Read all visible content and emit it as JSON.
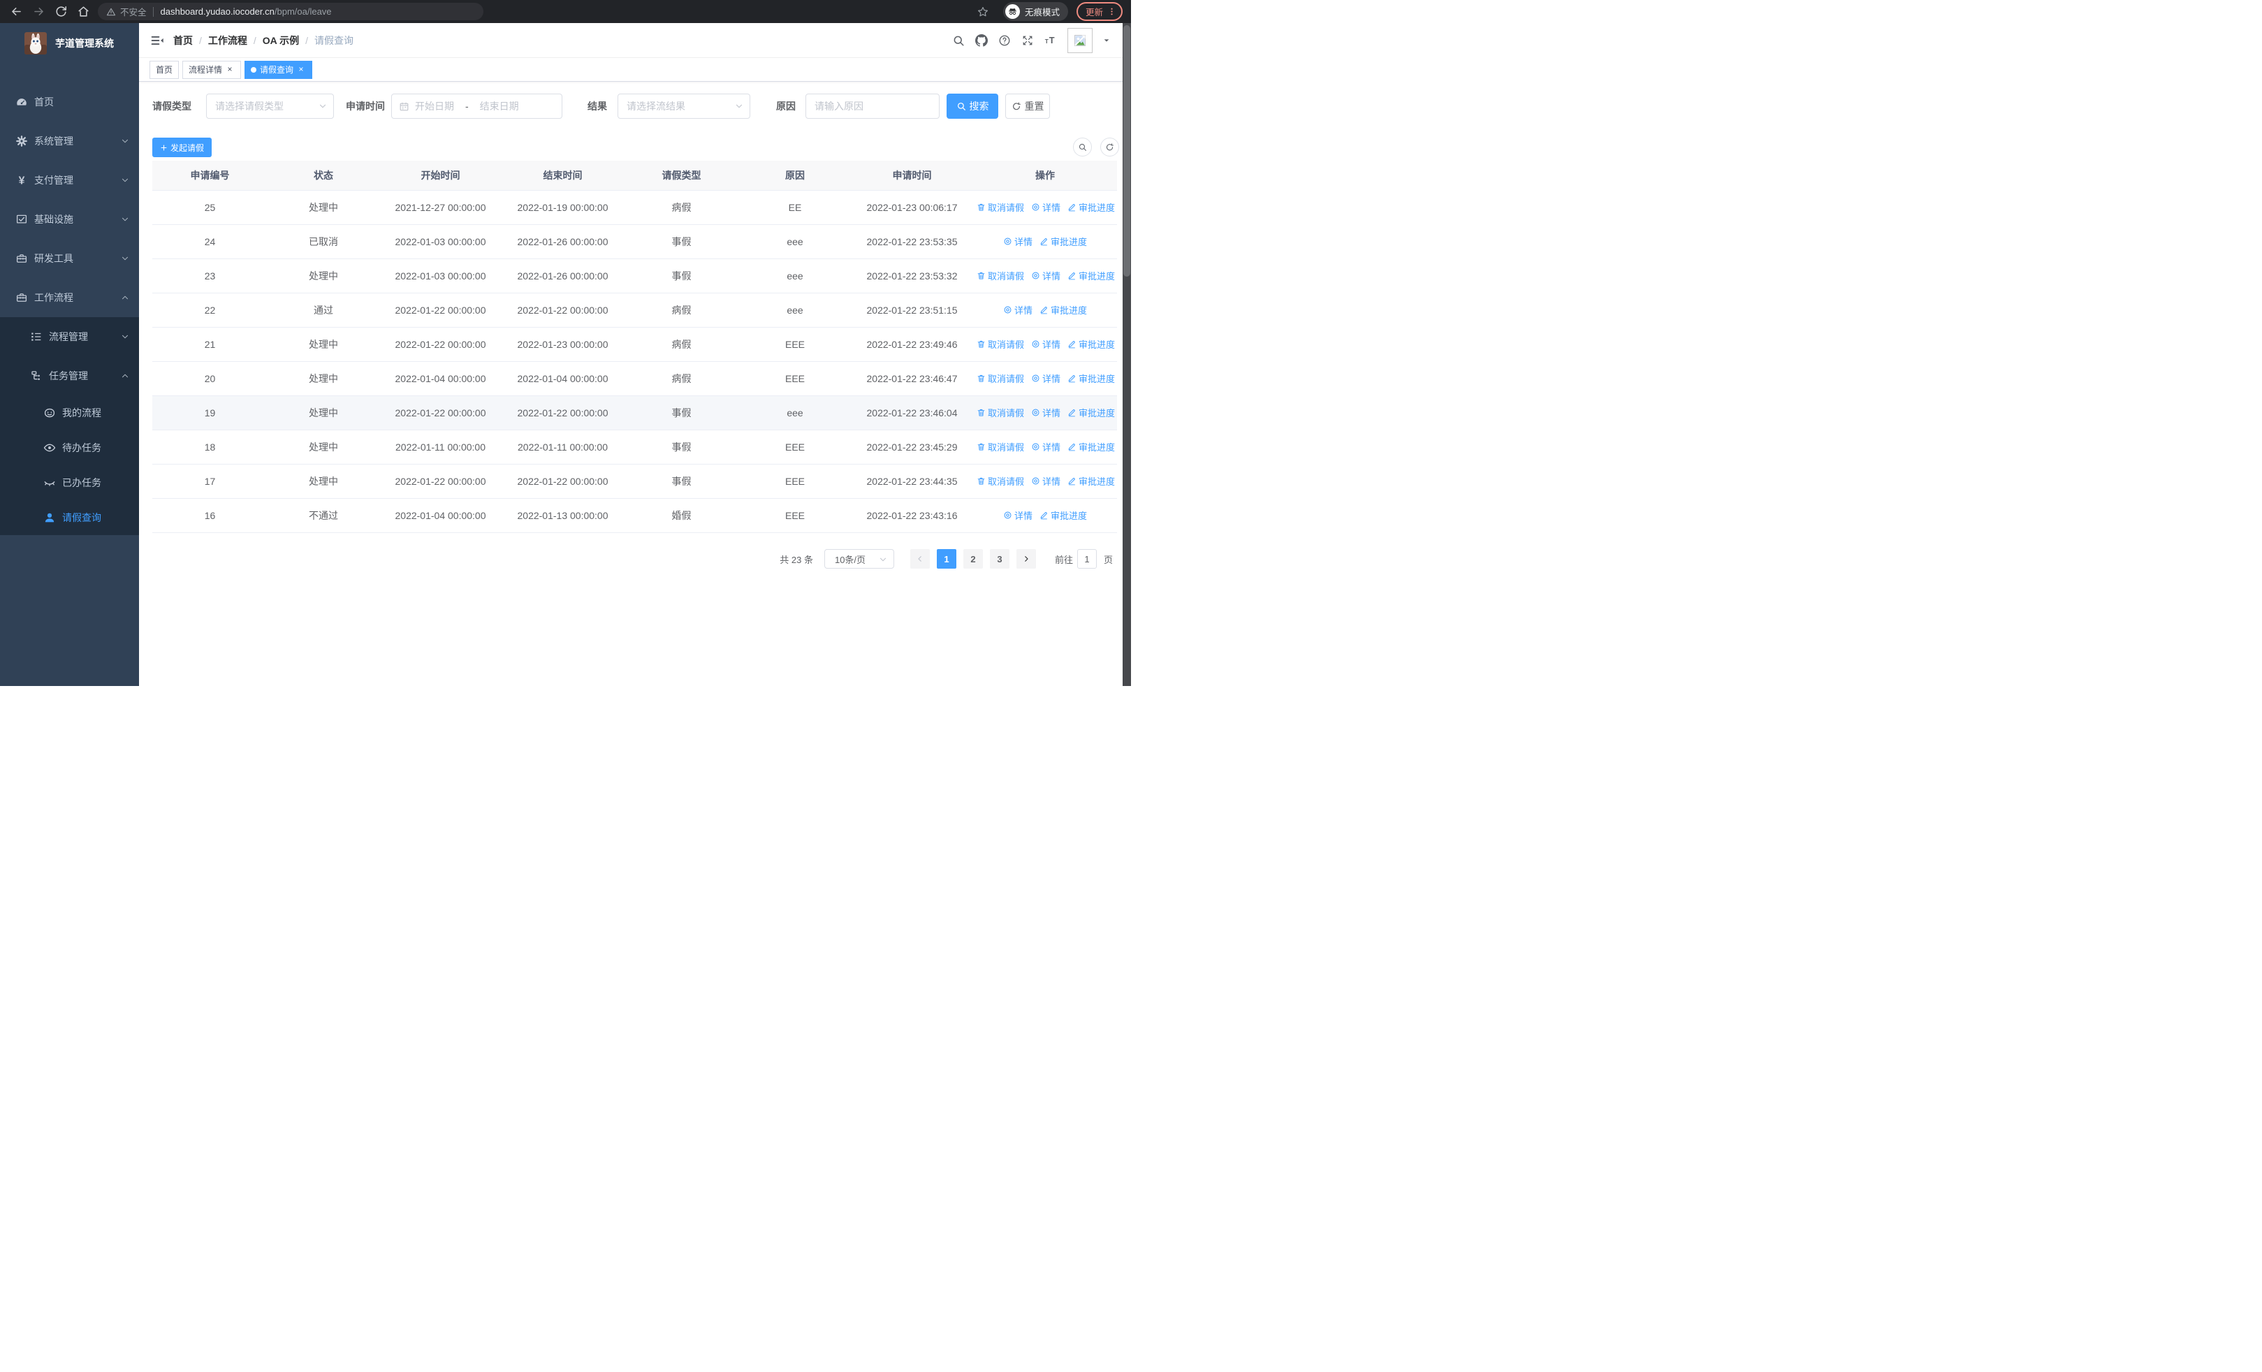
{
  "browser": {
    "security_label": "不安全",
    "url_domain": "dashboard.yudao.iocoder.cn",
    "url_path": "/bpm/oa/leave",
    "incognito_label": "无痕模式",
    "update_label": "更新"
  },
  "sidebar": {
    "app_title": "芋道管理系统",
    "items": [
      {
        "id": "home",
        "label": "首页",
        "icon": "dashboard-icon",
        "level": 1,
        "arrow": "",
        "sub": false,
        "active": false
      },
      {
        "id": "system",
        "label": "系统管理",
        "icon": "gear-icon",
        "level": 1,
        "arrow": "down",
        "sub": false,
        "active": false
      },
      {
        "id": "payment",
        "label": "支付管理",
        "icon": "yen-icon",
        "level": 1,
        "arrow": "down",
        "sub": false,
        "active": false
      },
      {
        "id": "infra",
        "label": "基础设施",
        "icon": "monitor-icon",
        "level": 1,
        "arrow": "down",
        "sub": false,
        "active": false
      },
      {
        "id": "devtools",
        "label": "研发工具",
        "icon": "toolbox-icon",
        "level": 1,
        "arrow": "down",
        "sub": false,
        "active": false
      },
      {
        "id": "workflow",
        "label": "工作流程",
        "icon": "toolbox-icon",
        "level": 1,
        "arrow": "up",
        "sub": false,
        "active": false
      },
      {
        "id": "process-mgmt",
        "label": "流程管理",
        "icon": "tree-icon",
        "level": 2,
        "arrow": "down",
        "sub": true,
        "active": false
      },
      {
        "id": "task-mgmt",
        "label": "任务管理",
        "icon": "flow-icon",
        "level": 2,
        "arrow": "up",
        "sub": true,
        "active": false
      },
      {
        "id": "my-process",
        "label": "我的流程",
        "icon": "face-icon",
        "level": 3,
        "arrow": "",
        "sub": true,
        "active": false
      },
      {
        "id": "todo-task",
        "label": "待办任务",
        "icon": "eye-open-icon",
        "level": 3,
        "arrow": "",
        "sub": true,
        "active": false
      },
      {
        "id": "done-task",
        "label": "已办任务",
        "icon": "eye-closed-icon",
        "level": 3,
        "arrow": "",
        "sub": true,
        "active": false
      },
      {
        "id": "leave-query",
        "label": "请假查询",
        "icon": "user-icon",
        "level": 3,
        "arrow": "",
        "sub": true,
        "active": true
      }
    ]
  },
  "header": {
    "breadcrumb": [
      "首页",
      "工作流程",
      "OA 示例",
      "请假查询"
    ]
  },
  "tabs": [
    {
      "label": "首页",
      "closable": false,
      "active": false
    },
    {
      "label": "流程详情",
      "closable": true,
      "active": false
    },
    {
      "label": "请假查询",
      "closable": true,
      "active": true
    }
  ],
  "filters": {
    "leave_type_label": "请假类型",
    "leave_type_placeholder": "请选择请假类型",
    "apply_time_label": "申请时间",
    "start_date_placeholder": "开始日期",
    "range_separator": "-",
    "end_date_placeholder": "结束日期",
    "result_label": "结果",
    "result_placeholder": "请选择流结果",
    "reason_label": "原因",
    "reason_placeholder": "请输入原因",
    "search_label": "搜索",
    "reset_label": "重置"
  },
  "toolbar": {
    "create_label": "发起请假"
  },
  "table": {
    "columns": [
      "申请编号",
      "状态",
      "开始时间",
      "结束时间",
      "请假类型",
      "原因",
      "申请时间",
      "操作"
    ],
    "action_labels": {
      "cancel": "取消请假",
      "detail": "详情",
      "progress": "审批进度"
    },
    "rows": [
      {
        "id": "25",
        "status": "处理中",
        "start": "2021-12-27 00:00:00",
        "end": "2022-01-19 00:00:00",
        "type": "病假",
        "reason": "EE",
        "applied": "2022-01-23 00:06:17",
        "cancel": true,
        "highlight": false
      },
      {
        "id": "24",
        "status": "已取消",
        "start": "2022-01-03 00:00:00",
        "end": "2022-01-26 00:00:00",
        "type": "事假",
        "reason": "eee",
        "applied": "2022-01-22 23:53:35",
        "cancel": false,
        "highlight": false
      },
      {
        "id": "23",
        "status": "处理中",
        "start": "2022-01-03 00:00:00",
        "end": "2022-01-26 00:00:00",
        "type": "事假",
        "reason": "eee",
        "applied": "2022-01-22 23:53:32",
        "cancel": true,
        "highlight": false
      },
      {
        "id": "22",
        "status": "通过",
        "start": "2022-01-22 00:00:00",
        "end": "2022-01-22 00:00:00",
        "type": "病假",
        "reason": "eee",
        "applied": "2022-01-22 23:51:15",
        "cancel": false,
        "highlight": false
      },
      {
        "id": "21",
        "status": "处理中",
        "start": "2022-01-22 00:00:00",
        "end": "2022-01-23 00:00:00",
        "type": "病假",
        "reason": "EEE",
        "applied": "2022-01-22 23:49:46",
        "cancel": true,
        "highlight": false
      },
      {
        "id": "20",
        "status": "处理中",
        "start": "2022-01-04 00:00:00",
        "end": "2022-01-04 00:00:00",
        "type": "病假",
        "reason": "EEE",
        "applied": "2022-01-22 23:46:47",
        "cancel": true,
        "highlight": false
      },
      {
        "id": "19",
        "status": "处理中",
        "start": "2022-01-22 00:00:00",
        "end": "2022-01-22 00:00:00",
        "type": "事假",
        "reason": "eee",
        "applied": "2022-01-22 23:46:04",
        "cancel": true,
        "highlight": true
      },
      {
        "id": "18",
        "status": "处理中",
        "start": "2022-01-11 00:00:00",
        "end": "2022-01-11 00:00:00",
        "type": "事假",
        "reason": "EEE",
        "applied": "2022-01-22 23:45:29",
        "cancel": true,
        "highlight": false
      },
      {
        "id": "17",
        "status": "处理中",
        "start": "2022-01-22 00:00:00",
        "end": "2022-01-22 00:00:00",
        "type": "事假",
        "reason": "EEE",
        "applied": "2022-01-22 23:44:35",
        "cancel": true,
        "highlight": false
      },
      {
        "id": "16",
        "status": "不通过",
        "start": "2022-01-04 00:00:00",
        "end": "2022-01-13 00:00:00",
        "type": "婚假",
        "reason": "EEE",
        "applied": "2022-01-22 23:43:16",
        "cancel": false,
        "highlight": false
      }
    ]
  },
  "pagination": {
    "total_label": "共 23 条",
    "page_size": "10条/页",
    "pages": [
      "1",
      "2",
      "3"
    ],
    "active_page": "1",
    "goto_label": "前往",
    "goto_value": "1",
    "page_label": "页"
  },
  "colors": {
    "primary": "#409eff",
    "link": "#409eff",
    "sidebar_bg": "#304156",
    "sidebar_submenu_bg": "#1f2d3d",
    "sidebar_text": "#bfcbd9",
    "table_header_bg": "#f8f8f9",
    "highlight_row_bg": "#f5f7fa",
    "update_badge": "#ef8b80"
  }
}
